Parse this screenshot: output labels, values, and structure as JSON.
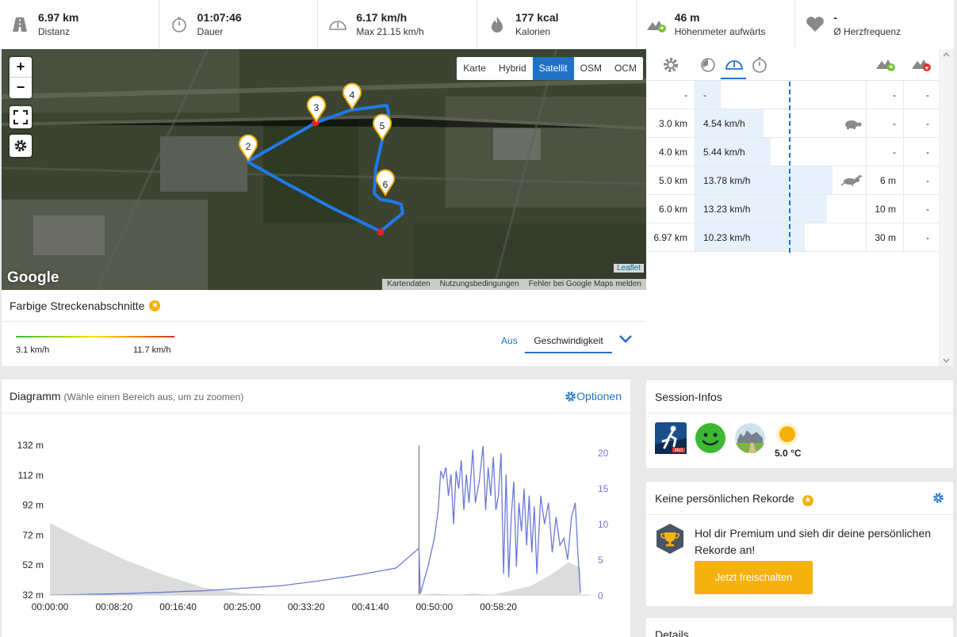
{
  "stats": [
    {
      "icon": "road-icon",
      "value": "6.97 km",
      "label": "Distanz"
    },
    {
      "icon": "stopwatch-icon",
      "value": "01:07:46",
      "label": "Dauer"
    },
    {
      "icon": "speedometer-icon",
      "value": "6.17 km/h",
      "label": "Max 21.15 km/h"
    },
    {
      "icon": "flame-icon",
      "value": "177 kcal",
      "label": "Kalorien"
    },
    {
      "icon": "elevation-up-icon",
      "value": "46 m",
      "label": "Höhenmeter aufwärts"
    },
    {
      "icon": "heart-icon",
      "value": "-",
      "label": "Ø Herzfrequenz"
    }
  ],
  "map": {
    "zoom_in": "+",
    "zoom_out": "−",
    "layers": [
      "Karte",
      "Hybrid",
      "Satellit",
      "OSM",
      "OCM"
    ],
    "active_layer": "Satellit",
    "markers": [
      "2",
      "3",
      "4",
      "5",
      "6"
    ],
    "google_logo": "Google",
    "leaflet": "Leaflet",
    "footer": [
      "Kartendaten",
      "Nutzungsbedingungen",
      "Fehler bei Google Maps melden"
    ]
  },
  "segments": {
    "title": "Farbige Streckenabschnitte",
    "min": "3.1 km/h",
    "max": "11.7 km/h",
    "off_label": "Aus",
    "selected": "Geschwindigkeit"
  },
  "laps": {
    "rows": [
      {
        "dist": "-",
        "speed": "-",
        "up": "-",
        "down": "-",
        "bar": 0.15,
        "marker": ""
      },
      {
        "dist": "3.0 km",
        "speed": "4.54 km/h",
        "up": "-",
        "down": "-",
        "bar": 0.4,
        "marker": "turtle-icon"
      },
      {
        "dist": "4.0 km",
        "speed": "5.44 km/h",
        "up": "-",
        "down": "-",
        "bar": 0.44,
        "marker": ""
      },
      {
        "dist": "5.0 km",
        "speed": "13.78 km/h",
        "up": "6 m",
        "down": "-",
        "bar": 0.8,
        "marker": "rabbit-icon"
      },
      {
        "dist": "6.0 km",
        "speed": "13.23 km/h",
        "up": "10 m",
        "down": "-",
        "bar": 0.77,
        "marker": ""
      },
      {
        "dist": "6.97 km",
        "speed": "10.23 km/h",
        "up": "30 m",
        "down": "-",
        "bar": 0.64,
        "marker": ""
      }
    ]
  },
  "diagram": {
    "title": "Diagramm",
    "subtitle": "(Wähle einen Bereich aus, um zu zoomen)",
    "options": "Optionen"
  },
  "chart_data": {
    "type": "area",
    "x": [
      "00:00:00",
      "00:08:20",
      "00:16:40",
      "00:25:00",
      "00:33:20",
      "00:41:40",
      "00:50:00",
      "00:58:20"
    ],
    "y_left_ticks": [
      "132 m",
      "112 m",
      "92 m",
      "72 m",
      "52 m",
      "32 m"
    ],
    "y_right_ticks": [
      "20",
      "15",
      "10",
      "5",
      "0"
    ],
    "ylim_left": [
      32,
      132
    ],
    "ylim_right": [
      0,
      20
    ],
    "series": [
      {
        "color": "#dcdcdc",
        "axis": "left",
        "kind": "area",
        "points": [
          [
            0,
            80
          ],
          [
            300,
            67
          ],
          [
            600,
            55
          ],
          [
            900,
            45
          ],
          [
            1200,
            37
          ],
          [
            1500,
            33
          ],
          [
            1800,
            32
          ],
          [
            2100,
            32
          ],
          [
            2400,
            32
          ],
          [
            2700,
            32
          ],
          [
            2880,
            32
          ],
          [
            3000,
            33
          ],
          [
            3150,
            32
          ],
          [
            3300,
            33
          ],
          [
            3450,
            32
          ],
          [
            3600,
            35
          ],
          [
            3750,
            38
          ],
          [
            3900,
            45
          ],
          [
            4050,
            54
          ],
          [
            4140,
            50
          ]
        ]
      },
      {
        "color": "#6a79d6",
        "axis": "right",
        "kind": "line",
        "points": [
          [
            0,
            0.0
          ],
          [
            600,
            0.2
          ],
          [
            1200,
            0.6
          ],
          [
            1800,
            1.3
          ],
          [
            2100,
            2.0
          ],
          [
            2400,
            2.8
          ],
          [
            2700,
            3.8
          ],
          [
            2880,
            6.6
          ],
          [
            2890,
            0.2
          ],
          [
            2950,
            4.0
          ],
          [
            3000,
            8.0
          ],
          [
            3030,
            12.0
          ],
          [
            3050,
            17.5
          ],
          [
            3070,
            16.5
          ],
          [
            3090,
            18.0
          ],
          [
            3110,
            14.0
          ],
          [
            3130,
            17.0
          ],
          [
            3150,
            10.0
          ],
          [
            3170,
            17.5
          ],
          [
            3190,
            15.0
          ],
          [
            3210,
            19.0
          ],
          [
            3230,
            12.0
          ],
          [
            3250,
            17.0
          ],
          [
            3270,
            13.0
          ],
          [
            3300,
            20.5
          ],
          [
            3320,
            13.0
          ],
          [
            3350,
            16.0
          ],
          [
            3380,
            21.0
          ],
          [
            3400,
            12.0
          ],
          [
            3420,
            18.0
          ],
          [
            3440,
            14.0
          ],
          [
            3460,
            19.5
          ],
          [
            3480,
            12.0
          ],
          [
            3500,
            14.0
          ],
          [
            3520,
            20.0
          ],
          [
            3540,
            3.0
          ],
          [
            3560,
            17.0
          ],
          [
            3580,
            2.5
          ],
          [
            3600,
            11.0
          ],
          [
            3620,
            16.0
          ],
          [
            3640,
            4.0
          ],
          [
            3660,
            13.0
          ],
          [
            3680,
            9.0
          ],
          [
            3700,
            15.0
          ],
          [
            3720,
            7.0
          ],
          [
            3740,
            14.0
          ],
          [
            3760,
            6.0
          ],
          [
            3780,
            12.5
          ],
          [
            3800,
            3.0
          ],
          [
            3830,
            14.0
          ],
          [
            3860,
            10.0
          ],
          [
            3890,
            13.0
          ],
          [
            3920,
            6.0
          ],
          [
            3950,
            11.0
          ],
          [
            3980,
            7.0
          ],
          [
            4010,
            8.0
          ],
          [
            4040,
            5.0
          ],
          [
            4070,
            11.0
          ],
          [
            4100,
            13.0
          ],
          [
            4120,
            6.0
          ],
          [
            4140,
            0.3
          ]
        ]
      }
    ]
  },
  "session": {
    "title": "Session-Infos",
    "temperature": "5.0 °C"
  },
  "records": {
    "title": "Keine persönlichen Rekorde",
    "text_line1": "Hol dir Premium und sieh dir deine persönlichen",
    "text_line2": "Rekorde an!",
    "button": "Jetzt freischalten"
  },
  "details": {
    "title": "Details"
  },
  "colors": {
    "accent": "#1e72c7",
    "premium": "#f5b10e",
    "route": "#1f7ae8"
  }
}
